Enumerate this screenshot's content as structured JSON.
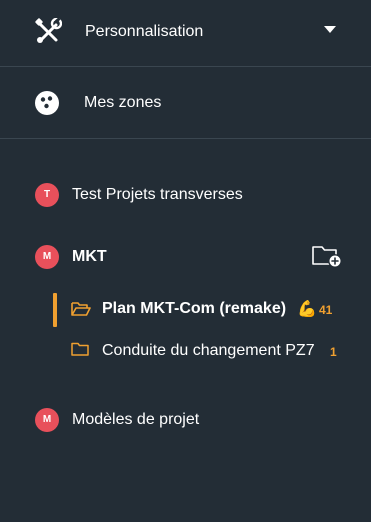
{
  "menu": {
    "personalisation_label": "Personnalisation",
    "zones_label": "Mes zones"
  },
  "workspaces": [
    {
      "initial": "T",
      "name": "Test Projets transverses"
    },
    {
      "initial": "M",
      "name": "MKT",
      "projects": [
        {
          "name": "Plan MKT-Com (remake)",
          "emoji": "💪",
          "count": "41",
          "active": true
        },
        {
          "name": "Conduite du changement PZ7",
          "count": "1",
          "active": false
        }
      ]
    },
    {
      "initial": "M",
      "name": "Modèles de projet"
    }
  ],
  "colors": {
    "background": "#232d36",
    "avatar": "#e8505b",
    "accent": "#f0a030",
    "divider": "#3a4650"
  },
  "icons": {
    "personalisation": "tools-icon",
    "dropdown": "caret-down-icon",
    "zones": "bowling-ball-icon",
    "new_folder": "folder-add-icon",
    "open_folder": "folder-open-icon",
    "folder": "folder-icon"
  }
}
